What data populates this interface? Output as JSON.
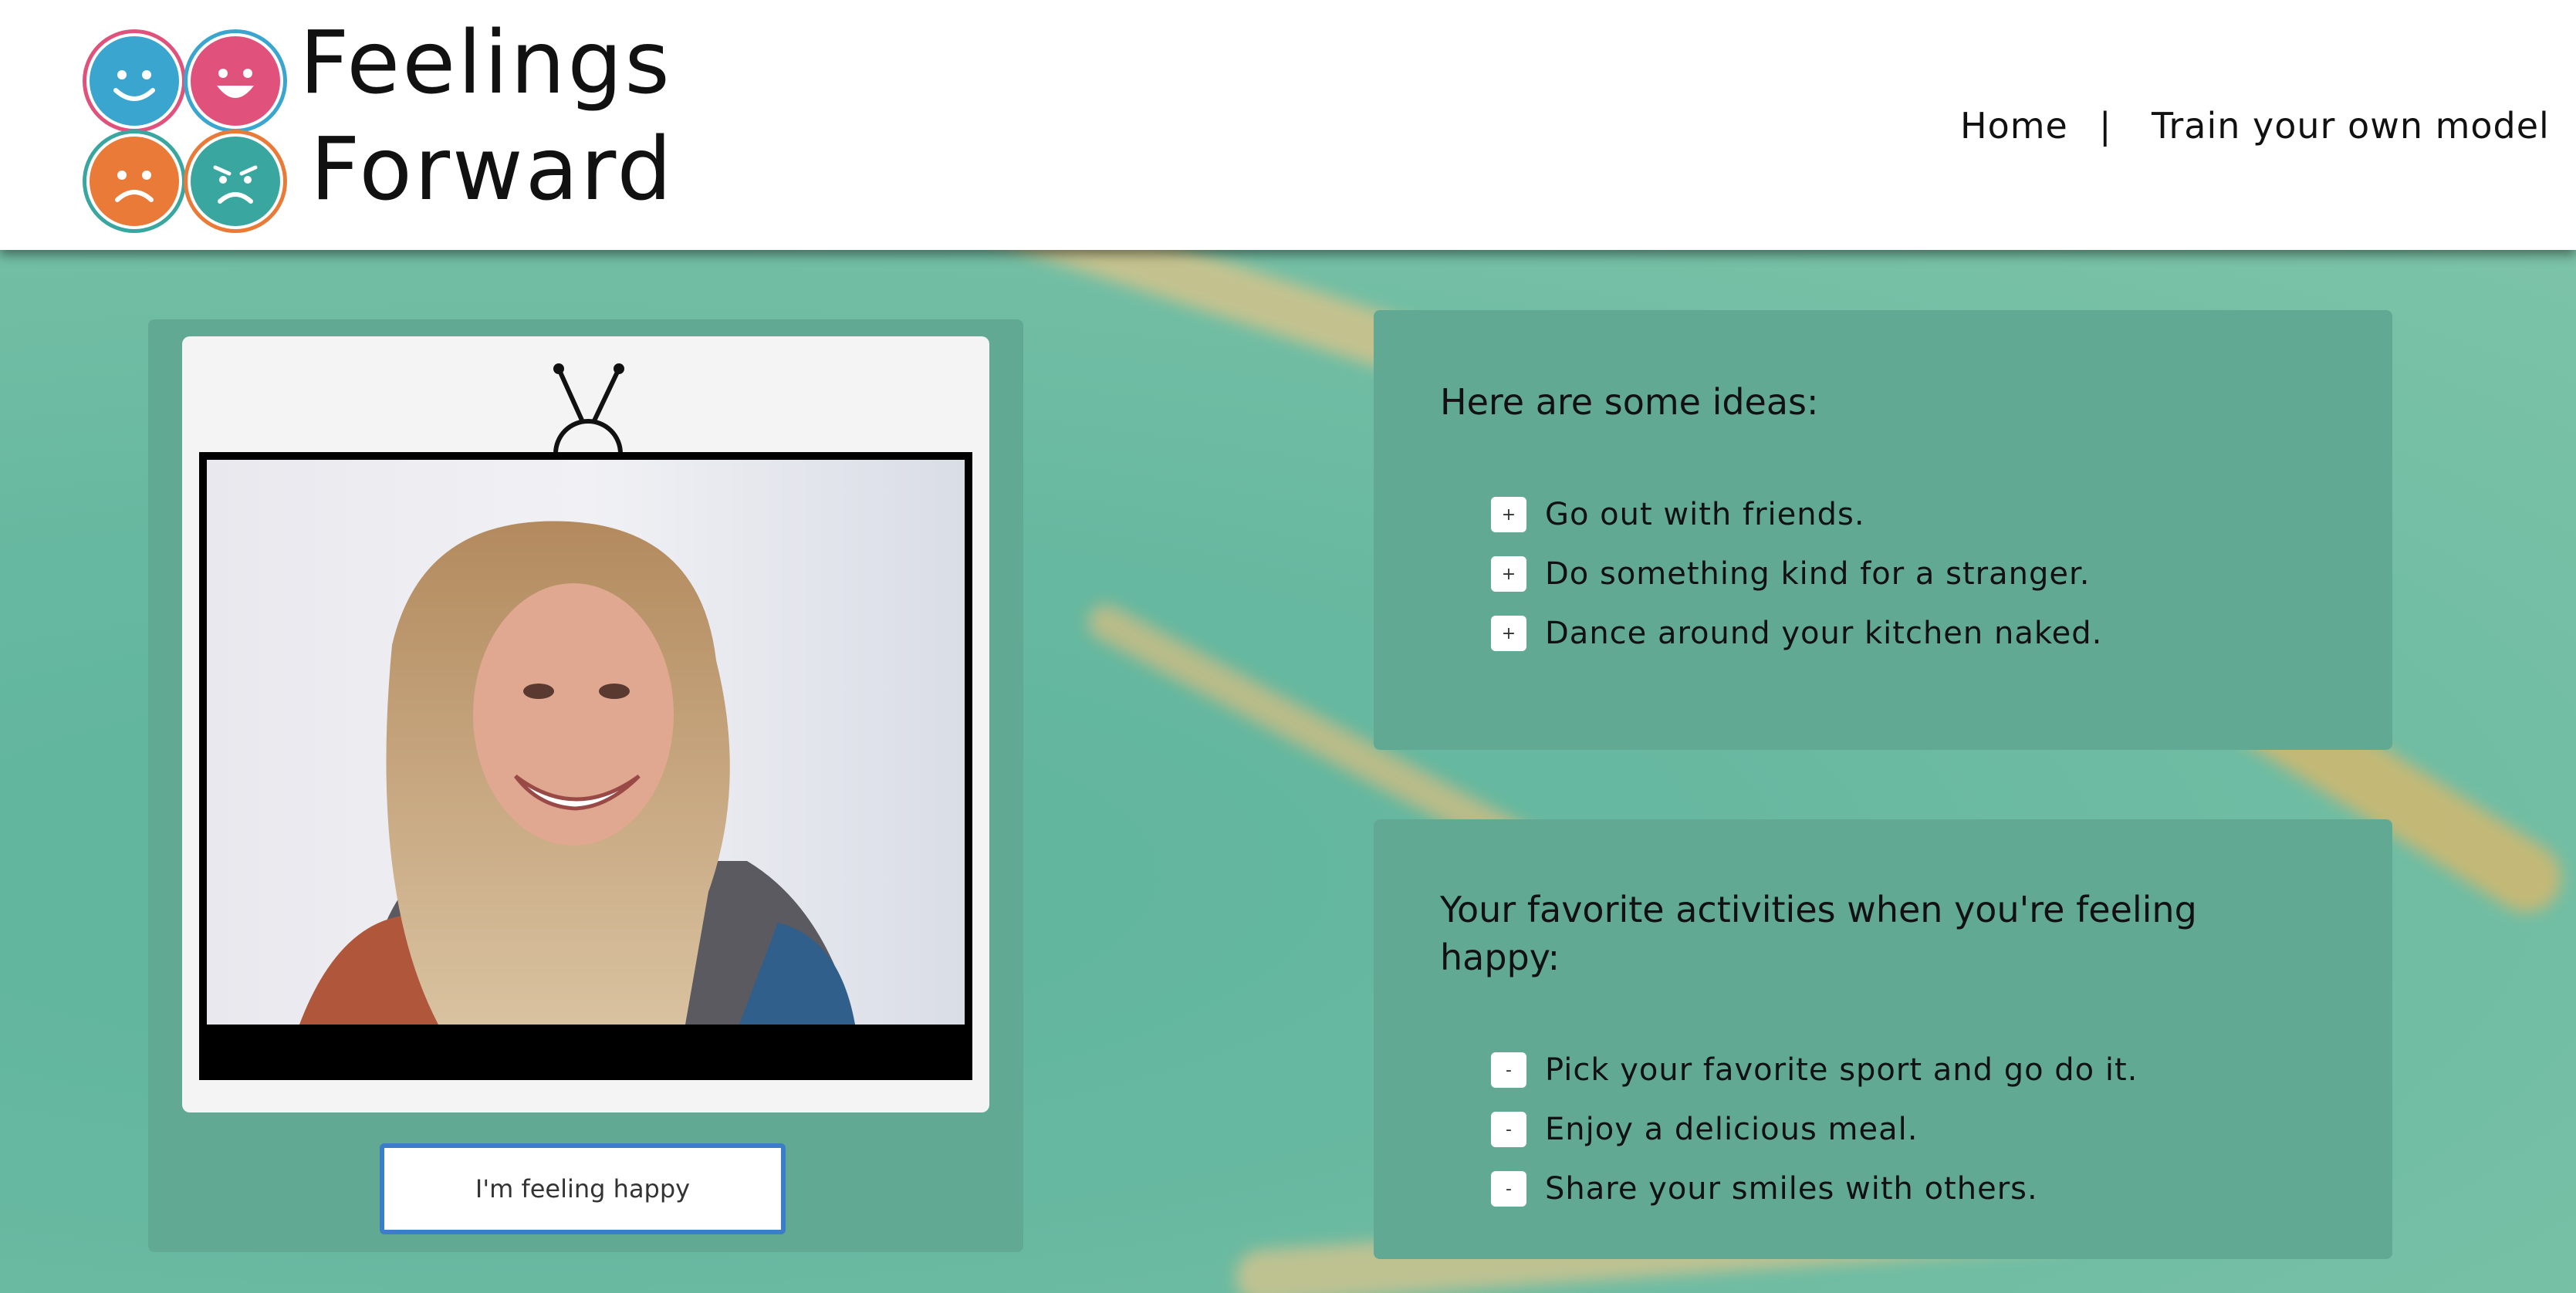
{
  "header": {
    "brand_line1": "Feelings",
    "brand_line2": "Forward",
    "nav": {
      "home": "Home",
      "separator": "|",
      "train": "Train your own model"
    }
  },
  "logo": {
    "faces": [
      {
        "icon": "happy-face-icon",
        "fill": "#3aa6cf",
        "ring": "#e0527c"
      },
      {
        "icon": "grin-face-icon",
        "fill": "#e0527c",
        "ring": "#3aa6cf"
      },
      {
        "icon": "sad-face-icon",
        "fill": "#ea7a37",
        "ring": "#3aa6a0"
      },
      {
        "icon": "worried-face-icon",
        "fill": "#3aa6a0",
        "ring": "#ea7a37"
      }
    ]
  },
  "webcam": {
    "button_label": "I'm feeling happy"
  },
  "ideas": {
    "title": "Here are some ideas:",
    "button_symbol": "+",
    "items": [
      "Go out with friends.",
      "Do something kind for a stranger.",
      "Dance around your kitchen naked."
    ]
  },
  "favorites": {
    "title": "Your favorite activities when you're feeling happy:",
    "button_symbol": "-",
    "items": [
      "Pick your favorite sport and go do it.",
      "Enjoy a delicious meal.",
      "Share your smiles with others."
    ]
  },
  "colors": {
    "card": "#62a994",
    "button_border": "#3b7dc6",
    "background": "#6cbba4"
  }
}
